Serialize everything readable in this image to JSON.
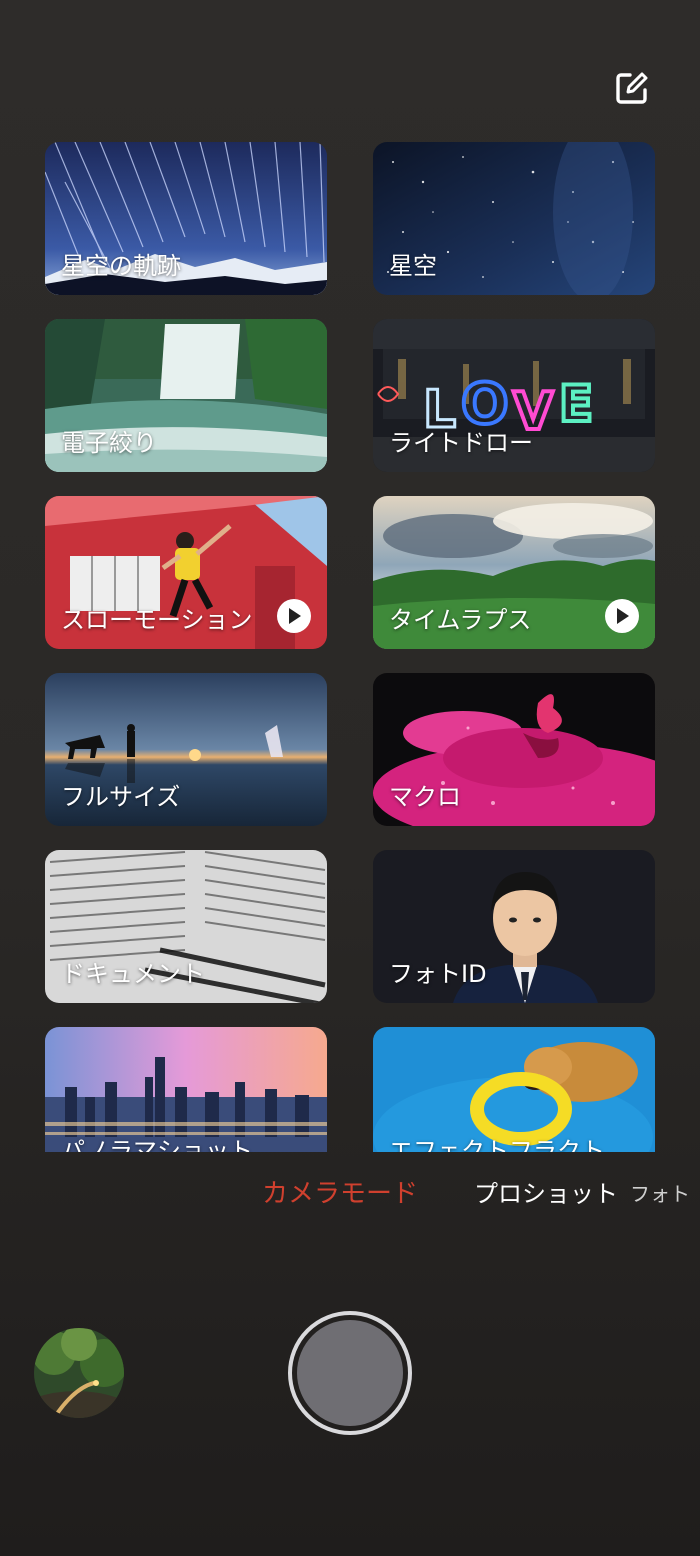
{
  "header": {
    "edit_icon": "edit-icon"
  },
  "cards": [
    {
      "label": "星空の軌跡",
      "video": false
    },
    {
      "label": "星空",
      "video": false
    },
    {
      "label": "電子絞り",
      "video": false
    },
    {
      "label": "ライトドロー",
      "video": false
    },
    {
      "label": "スローモーション",
      "video": true
    },
    {
      "label": "タイムラプス",
      "video": true
    },
    {
      "label": "フルサイズ",
      "video": false
    },
    {
      "label": "マクロ",
      "video": false
    },
    {
      "label": "ドキュメント",
      "video": false
    },
    {
      "label": "フォトID",
      "video": false
    },
    {
      "label": "パノラマショット",
      "video": false
    },
    {
      "label": "エフェクトフラクト",
      "video": false
    }
  ],
  "mode_bar": {
    "active": "カメラモード",
    "next": "プロショット",
    "next2": "フォト",
    "active_color": "#d0402e"
  },
  "controls": {
    "gallery_icon": "gallery-thumbnail",
    "shutter_icon": "shutter-button"
  }
}
